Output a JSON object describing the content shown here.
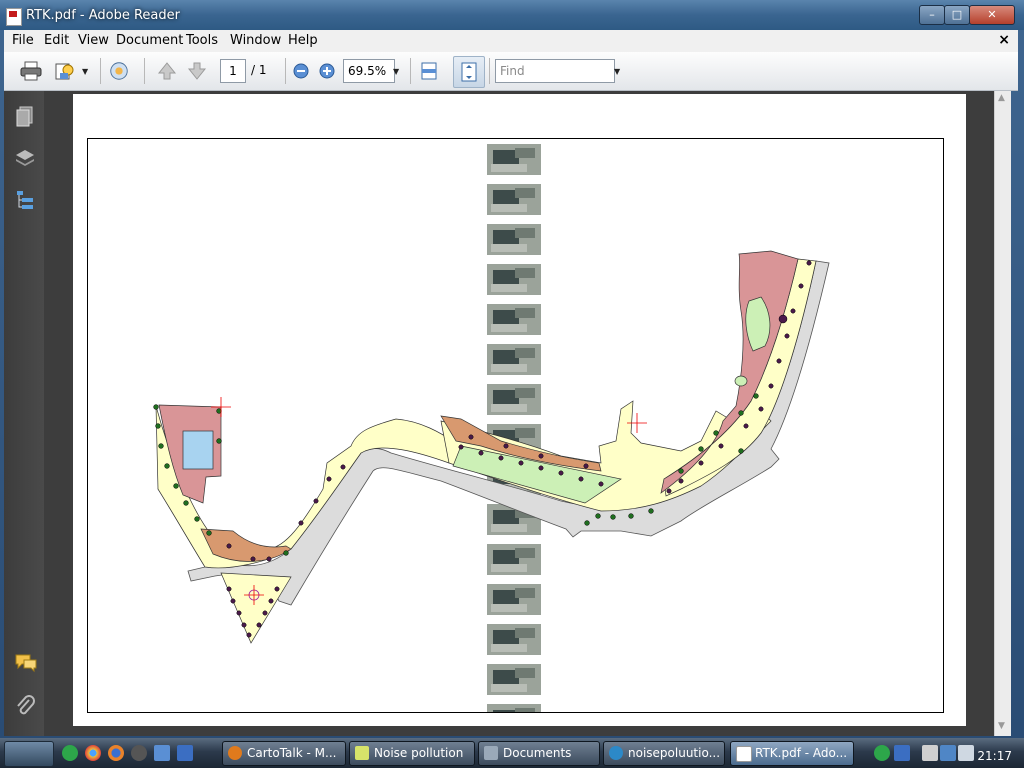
{
  "window": {
    "title": "RTK.pdf - Adobe Reader",
    "controls": {
      "minimize": "–",
      "maximize": "□",
      "close": "✕"
    }
  },
  "menubar": {
    "items": [
      "File",
      "Edit",
      "View",
      "Document",
      "Tools",
      "Window",
      "Help"
    ],
    "close_glyph": "×"
  },
  "toolbar": {
    "page_current": "1",
    "page_total": "/ 1",
    "zoom": "69.5%",
    "find_placeholder": "Find"
  },
  "taskbar": {
    "tasks": [
      {
        "label": "CartoTalk - M...",
        "icon_color": "#e07a1c"
      },
      {
        "label": "Noise pollution",
        "icon_color": "#d7e36a"
      },
      {
        "label": "Documents",
        "icon_color": "#9aa9b9"
      },
      {
        "label": "noisepoluutio...",
        "icon_color": "#2c89c8"
      },
      {
        "label": "RTK.pdf - Ado...",
        "icon_color": "#c41b1b"
      }
    ],
    "clock": "21:17"
  },
  "colors": {
    "map_building": "#d99597",
    "map_yard": "#ffffc8",
    "map_orange": "#d8996f",
    "map_green": "#ccf0b6",
    "map_road": "#dcdcdc",
    "map_water": "#a8d3f0"
  }
}
